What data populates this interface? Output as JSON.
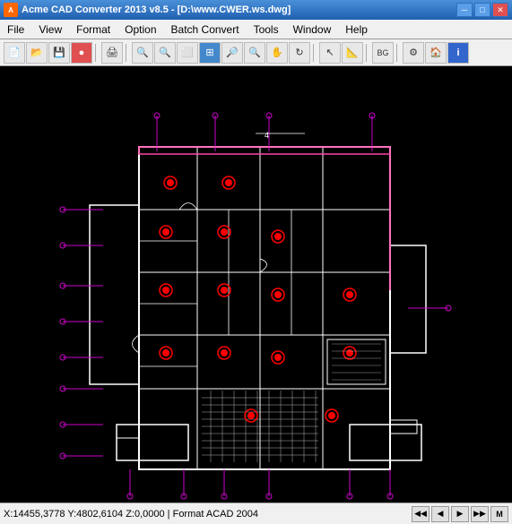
{
  "titleBar": {
    "title": "Acme CAD Converter 2013 v8.5 - [D:\\www.CWER.ws.dwg]",
    "minBtn": "─",
    "maxBtn": "□",
    "closeBtn": "✕"
  },
  "menuBar": {
    "items": [
      {
        "id": "file",
        "label": "File"
      },
      {
        "id": "view",
        "label": "View"
      },
      {
        "id": "format",
        "label": "Format"
      },
      {
        "id": "option",
        "label": "Option"
      },
      {
        "id": "batchConvert",
        "label": "Batch Convert"
      },
      {
        "id": "tools",
        "label": "Tools"
      },
      {
        "id": "window",
        "label": "Window"
      },
      {
        "id": "help",
        "label": "Help"
      }
    ]
  },
  "statusBar": {
    "coordinates": "X:14455,3778 Y:4802,6104 Z:0,0000 | Format ACAD 2004",
    "navBtns": [
      "◀◀",
      "◀",
      "▶",
      "▶▶",
      "M"
    ]
  }
}
